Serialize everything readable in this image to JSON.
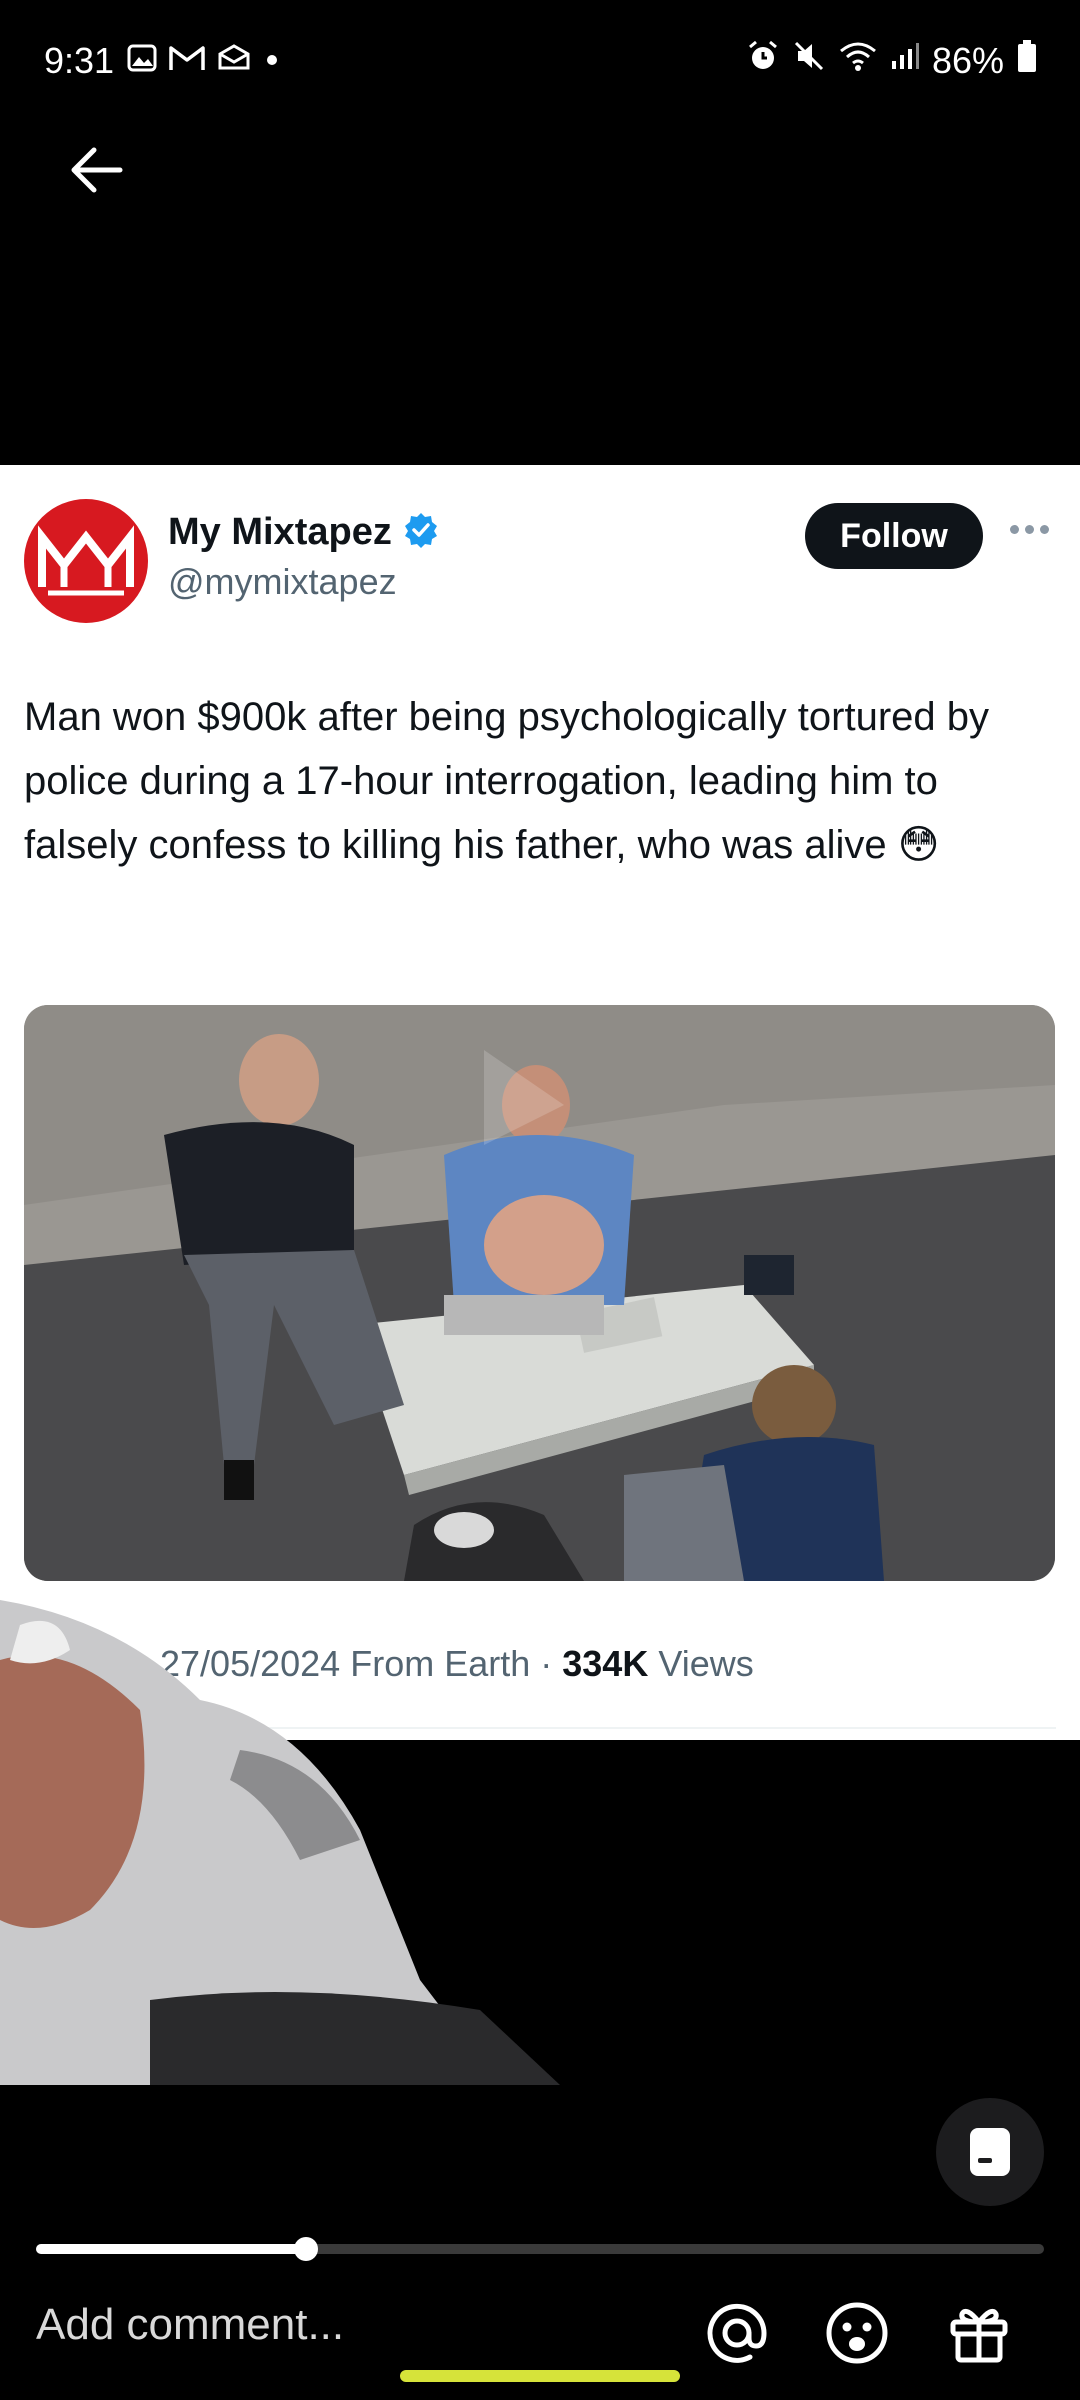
{
  "status_bar": {
    "time": "9:31",
    "battery": "86%",
    "left_icons": [
      "gallery-icon",
      "gmail-icon",
      "inbox-icon",
      "dot-icon"
    ],
    "right_icons": [
      "alarm-icon",
      "mute-icon",
      "wifi-icon",
      "signal-icon",
      "battery-icon"
    ]
  },
  "tweet": {
    "display_name": "My Mixtapez",
    "handle": "@mymixtapez",
    "avatar_text": "MM",
    "follow_label": "Follow",
    "text": "Man won $900k after being psychologically tortured by police during a 17-hour interrogation, leading him to falsely confess to killing his father, who was alive 😳",
    "meta": {
      "time_partial": "     PM",
      "date": "27/05/2024",
      "source": "From Earth",
      "views_count": "334K",
      "views_label": "Views"
    }
  },
  "player": {
    "progress": 0.268
  },
  "comment": {
    "placeholder": "Add comment..."
  },
  "colors": {
    "verified": "#1d9bf0",
    "follow_bg": "#0f1419",
    "avatar_red": "#d71920",
    "home_indicator": "#d6e33a"
  }
}
